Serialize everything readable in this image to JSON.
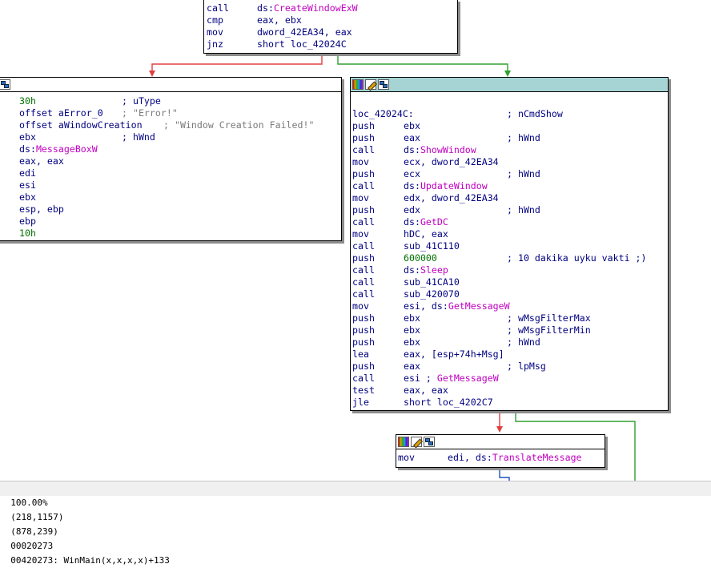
{
  "top_block": {
    "lines": [
      {
        "mnemonic": "call",
        "operand": "ds:",
        "api": "CreateWindowExW",
        "comment": ""
      },
      {
        "mnemonic": "cmp",
        "operand": "eax, ebx",
        "api": "",
        "comment": ""
      },
      {
        "mnemonic": "mov",
        "operand": "dword_42EA34, eax",
        "api": "",
        "comment": ""
      },
      {
        "mnemonic": "jnz",
        "operand": "short loc_42024C",
        "api": "",
        "comment": ""
      }
    ]
  },
  "left_block": {
    "lines": [
      {
        "operand": "30h",
        "type": "num",
        "comment": "; uType"
      },
      {
        "operand": "offset aError_0",
        "type": "plain",
        "comment": "; \"Error!\""
      },
      {
        "operand": "offset aWindowCreation",
        "type": "plain",
        "comment": "; \"Window Creation Failed!\""
      },
      {
        "operand": "ebx",
        "type": "plain",
        "comment": "; hWnd"
      },
      {
        "operand": "ds:",
        "api": "MessageBoxW",
        "type": "api",
        "comment": ""
      },
      {
        "operand": "eax, eax",
        "type": "plain",
        "comment": ""
      },
      {
        "operand": "edi",
        "type": "plain",
        "comment": ""
      },
      {
        "operand": "esi",
        "type": "plain",
        "comment": ""
      },
      {
        "operand": "ebx",
        "type": "plain",
        "comment": ""
      },
      {
        "operand": "esp, ebp",
        "type": "plain",
        "comment": ""
      },
      {
        "operand": "ebp",
        "type": "plain",
        "comment": ""
      },
      {
        "operand": "10h",
        "type": "num",
        "comment": ""
      }
    ]
  },
  "right_block": {
    "label": "loc_42024C:",
    "label_comment": "; nCmdShow",
    "lines": [
      {
        "mnemonic": "push",
        "operand": "ebx",
        "comment": ""
      },
      {
        "mnemonic": "push",
        "operand": "eax",
        "comment": "; hWnd"
      },
      {
        "mnemonic": "call",
        "operand": "ds:",
        "api": "ShowWindow",
        "comment": ""
      },
      {
        "mnemonic": "mov",
        "operand": "ecx, dword_42EA34",
        "comment": ""
      },
      {
        "mnemonic": "push",
        "operand": "ecx",
        "comment": "; hWnd"
      },
      {
        "mnemonic": "call",
        "operand": "ds:",
        "api": "UpdateWindow",
        "comment": ""
      },
      {
        "mnemonic": "mov",
        "operand": "edx, dword_42EA34",
        "comment": ""
      },
      {
        "mnemonic": "push",
        "operand": "edx",
        "comment": "; hWnd"
      },
      {
        "mnemonic": "call",
        "operand": "ds:",
        "api": "GetDC",
        "comment": ""
      },
      {
        "mnemonic": "mov",
        "operand": "hDC, eax",
        "comment": ""
      },
      {
        "mnemonic": "call",
        "operand": "sub_41C110",
        "comment": ""
      },
      {
        "mnemonic": "push",
        "operand": "600000",
        "num": true,
        "comment": "; 10 dakika uyku vakti ;)"
      },
      {
        "mnemonic": "call",
        "operand": "ds:",
        "api": "Sleep",
        "comment": ""
      },
      {
        "mnemonic": "call",
        "operand": "sub_41CA10",
        "comment": ""
      },
      {
        "mnemonic": "call",
        "operand": "sub_420070",
        "comment": ""
      },
      {
        "mnemonic": "mov",
        "operand": "esi, ds:",
        "api": "GetMessageW",
        "comment": ""
      },
      {
        "mnemonic": "push",
        "operand": "ebx",
        "comment": "; wMsgFilterMax"
      },
      {
        "mnemonic": "push",
        "operand": "ebx",
        "comment": "; wMsgFilterMin"
      },
      {
        "mnemonic": "push",
        "operand": "ebx",
        "comment": "; hWnd"
      },
      {
        "mnemonic": "lea",
        "operand": "eax, [esp+74h+Msg]",
        "comment": ""
      },
      {
        "mnemonic": "push",
        "operand": "eax",
        "comment": "; lpMsg"
      },
      {
        "mnemonic": "call",
        "operand": "esi ; ",
        "api": "GetMessageW",
        "comment": ""
      },
      {
        "mnemonic": "test",
        "operand": "eax, eax",
        "comment": ""
      },
      {
        "mnemonic": "jle",
        "operand": "short loc_4202C7",
        "comment": ""
      }
    ]
  },
  "bottom_block": {
    "lines": [
      {
        "mnemonic": "mov",
        "operand": "edi, ds:",
        "api": "TranslateMessage",
        "comment": ""
      }
    ]
  },
  "status_bar": {
    "zoom": "100.00%",
    "graph_coords": "(218,1157)",
    "mouse_coords": "(878,239)",
    "file_offset": "00020273",
    "address_location": "00420273: WinMain(x,x,x,x)+133"
  },
  "colors": {
    "node_header": "#a6d3d3",
    "edge_false": "#e04040",
    "edge_true": "#30a030",
    "edge_normal": "#2050c0",
    "api_name": "#c000c0",
    "number": "#007000"
  }
}
